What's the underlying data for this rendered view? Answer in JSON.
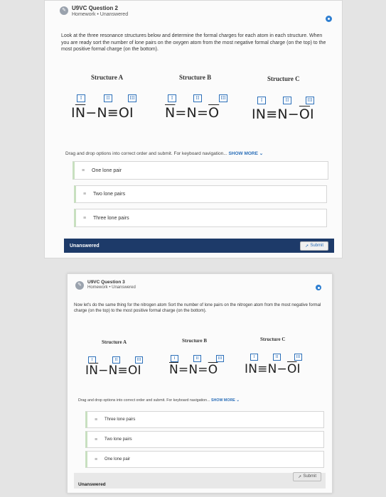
{
  "colors": {
    "accent": "#2a6eb8",
    "status_bar": "#1d3a69",
    "page_bg": "#e4e4e4"
  },
  "question1": {
    "title": "U9VC Question 2",
    "subtitle": "Homework • Unanswered",
    "prompt": "Look at the three resonance structures below and determine the formal charges for each atom in each structure. When you are ready sort the number of lone pairs on the oxygen atom from the most negative formal charge (on the top) to the most positive formal charge (on the bottom).",
    "structures": [
      {
        "label": "Structure A",
        "boxes": [
          "I",
          "II",
          "III"
        ]
      },
      {
        "label": "Structure B",
        "boxes": [
          "I",
          "II",
          "III"
        ]
      },
      {
        "label": "Structure C",
        "boxes": [
          "I",
          "II",
          "III"
        ]
      }
    ],
    "drag_hint": "Drag and drop options into correct order and submit. For keyboard navigation...",
    "show_more": "SHOW MORE",
    "options": [
      "One lone pair",
      "Two lone pairs",
      "Three lone pairs"
    ],
    "status": "Unanswered",
    "submit_label": "Submit"
  },
  "question2": {
    "title": "U9VC Question 3",
    "subtitle": "Homework • Unanswered",
    "prompt": "Now let's do the same thing for the nitrogen atom Sort the number of lone pairs on the nitrogen atom from the most negative formal charge (on the top) to the most positive formal charge (on the bottom).",
    "structures": [
      {
        "label": "Structure A",
        "boxes": [
          "I",
          "II",
          "III"
        ]
      },
      {
        "label": "Structure B",
        "boxes": [
          "I",
          "II",
          "III"
        ]
      },
      {
        "label": "Structure C",
        "boxes": [
          "I",
          "II",
          "III"
        ]
      }
    ],
    "drag_hint": "Drag and drop options into correct order and submit. For keyboard navigation...",
    "show_more": "SHOW MORE",
    "options": [
      "Three lone pairs",
      "Two lone pairs",
      "One lone pair"
    ],
    "status": "Unanswered",
    "submit_label": "Submit"
  }
}
